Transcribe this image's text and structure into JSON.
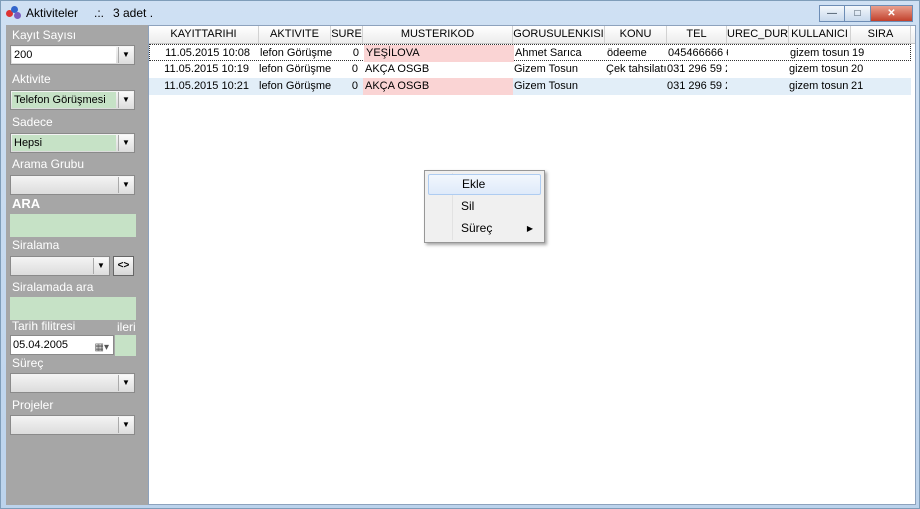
{
  "window": {
    "title": "Aktiviteler",
    "separator": ".:.",
    "count": "3 adet ."
  },
  "filters": {
    "kayit_sayisi": {
      "label": "Kayıt Sayısı",
      "value": "200"
    },
    "aktivite": {
      "label": "Aktivite",
      "value": "Telefon Görüşmesi"
    },
    "sadece": {
      "label": "Sadece",
      "value": "Hepsi"
    },
    "arama_grubu": {
      "label": "Arama Grubu",
      "value": ""
    },
    "ara": {
      "label": "ARA",
      "value": ""
    },
    "siralama": {
      "label": "Siralama",
      "value": "",
      "toggle_label": "<>"
    },
    "siralamada_ara": {
      "label": "Siralamada ara",
      "value": ""
    },
    "tarih_filitresi": {
      "label": "Tarih filitresi",
      "date": "05.04.2005",
      "partial": "ileri"
    },
    "surec": {
      "label": "Süreç",
      "value": ""
    },
    "projeler": {
      "label": "Projeler",
      "value": ""
    }
  },
  "grid": {
    "columns": [
      "KAYITTARIHI",
      "AKTIVITE",
      "SURE",
      "MUSTERIKOD",
      "GORUSULENKISI",
      "KONU",
      "TEL",
      "UREC_DURUI",
      "KULLANICI",
      "SIRA"
    ],
    "rows": [
      {
        "kayittarihi": "11.05.2015 10:08",
        "aktivite": "lefon Görüşme",
        "sure": "0",
        "musterikod": "YEŞİLOVA",
        "gorusulenkisi": "Ahmet Sarıca",
        "konu": "ödeeme",
        "tel": "045466666 6",
        "surec": "",
        "kullanici": "gizem tosun",
        "sira": "19"
      },
      {
        "kayittarihi": "11.05.2015 10:19",
        "aktivite": "lefon Görüşme",
        "sure": "0",
        "musterikod": "AKÇA OSGB",
        "gorusulenkisi": "Gizem Tosun",
        "konu": "Çek tahsilatı",
        "tel": "031 296 59 2",
        "surec": "",
        "kullanici": "gizem tosun",
        "sira": "20"
      },
      {
        "kayittarihi": "11.05.2015 10:21",
        "aktivite": "lefon Görüşme",
        "sure": "0",
        "musterikod": "AKÇA OSGB",
        "gorusulenkisi": "Gizem Tosun",
        "konu": "",
        "tel": "031 296 59 2",
        "surec": "",
        "kullanici": "gizem tosun",
        "sira": "21"
      }
    ]
  },
  "context_menu": {
    "items": [
      "Ekle",
      "Sil",
      "Süreç"
    ]
  }
}
